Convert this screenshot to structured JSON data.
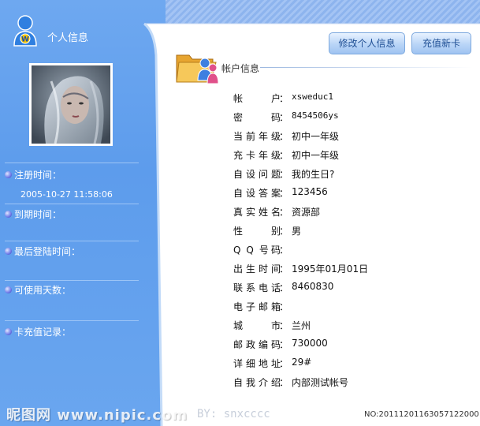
{
  "sidebar": {
    "title": "个人信息",
    "icon_letter": "W",
    "items": [
      {
        "label": "注册时间：",
        "value": "2005-10-27 11:58:06"
      },
      {
        "label": "到期时间：",
        "value": ""
      },
      {
        "label": "最后登陆时间：",
        "value": ""
      },
      {
        "label": "可使用天数：",
        "value": ""
      },
      {
        "label": "卡充值记录：",
        "value": ""
      }
    ]
  },
  "toolbar": {
    "edit_label": "修改个人信息",
    "recharge_label": "充值新卡"
  },
  "section": {
    "title": "帐户信息"
  },
  "account": {
    "rows": [
      {
        "label": "帐户",
        "value": "xsweduc1"
      },
      {
        "label": "密码",
        "value": "8454506ys"
      },
      {
        "label": "当前年级",
        "value": "初中一年级"
      },
      {
        "label": "充卡年级",
        "value": "初中一年级"
      },
      {
        "label": "自设问题",
        "value": "我的生日?"
      },
      {
        "label": "自设答案",
        "value": "123456"
      },
      {
        "label": "真实姓名",
        "value": "资源部"
      },
      {
        "label": "性别",
        "value": "男"
      },
      {
        "label": "Q Q 号码",
        "value": ""
      },
      {
        "label": "出生时间",
        "value": "1995年01月01日"
      },
      {
        "label": "联系电话",
        "value": "8460830"
      },
      {
        "label": "电子邮箱",
        "value": ""
      },
      {
        "label": "城市",
        "value": "兰州"
      },
      {
        "label": "邮政编码",
        "value": "730000"
      },
      {
        "label": "详细地址",
        "value": "29#"
      },
      {
        "label": "自我介绍",
        "value": "内部测试帐号"
      }
    ],
    "colon": "："
  },
  "watermark": {
    "text": "昵图网 www.nipic.com",
    "by": "BY: snxcccc",
    "serial": "NO:20111201163057122000"
  },
  "colors": {
    "sidebar": "#5d9cec",
    "button_text": "#1e4e94"
  }
}
